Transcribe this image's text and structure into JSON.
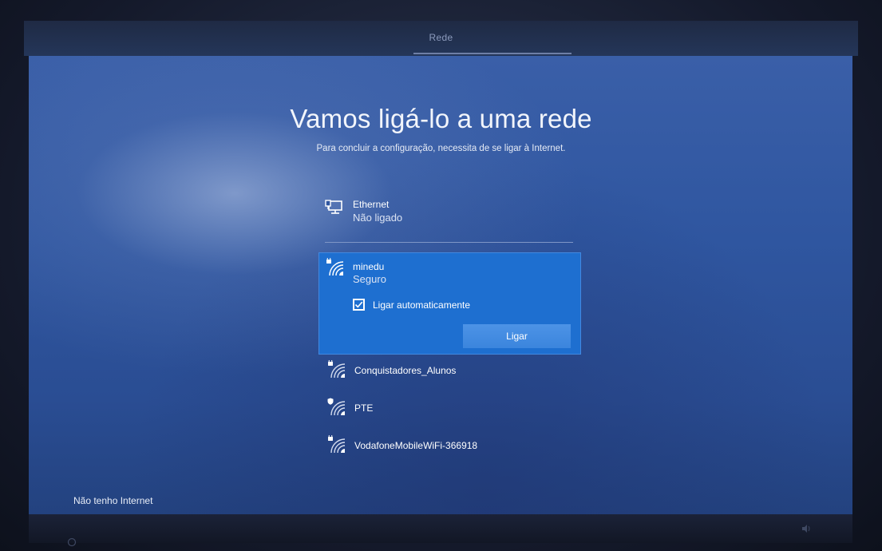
{
  "window": {
    "tab_title": "Rede"
  },
  "header": {
    "title": "Vamos ligá-lo a uma rede",
    "subtitle": "Para concluir a configuração, necessita de se ligar à Internet."
  },
  "ethernet": {
    "name": "Ethernet",
    "status": "Não ligado",
    "icon": "ethernet-icon"
  },
  "selected_network": {
    "name": "minedu",
    "status": "Seguro",
    "icon": "wifi-secured-icon",
    "auto_connect_label": "Ligar automaticamente",
    "auto_connect_checked": true,
    "connect_label": "Ligar"
  },
  "networks": [
    {
      "name": "Conquistadores_Alunos",
      "icon": "wifi-secured-icon"
    },
    {
      "name": "PTE",
      "icon": "wifi-shield-icon"
    },
    {
      "name": "VodafoneMobileWiFi-366918",
      "icon": "wifi-secured-icon"
    }
  ],
  "footer": {
    "no_internet_label": "Não tenho Internet"
  },
  "colors": {
    "background": "#2f56a0",
    "selected": "#1e6fd0",
    "button": "#3b85dd"
  }
}
